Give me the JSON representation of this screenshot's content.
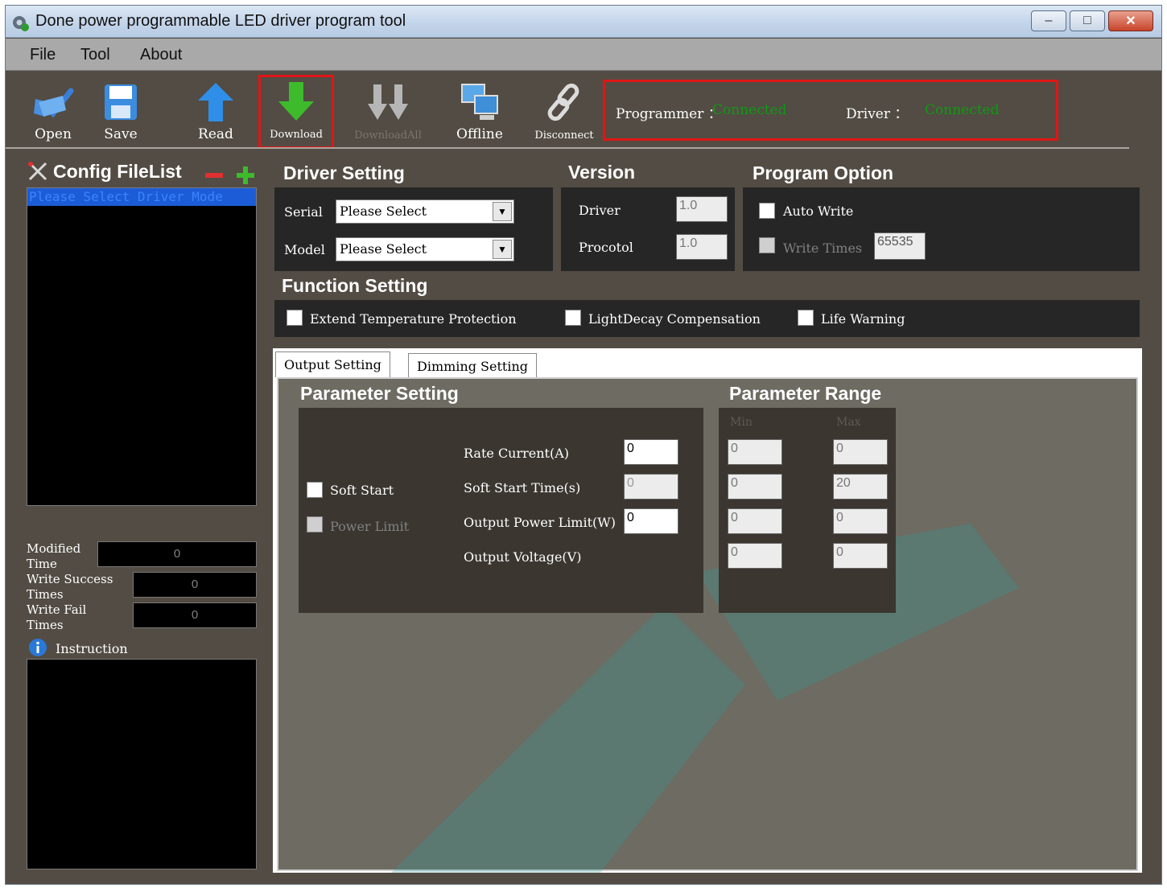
{
  "window": {
    "title": "Done power programmable LED driver program tool",
    "controls": {
      "minimize": "–",
      "maximize": "□",
      "close": "✕"
    }
  },
  "menu": [
    "File",
    "Tool",
    "About"
  ],
  "toolbar": {
    "buttons": [
      {
        "label": "Open",
        "icon": "folder-check-icon"
      },
      {
        "label": "Save",
        "icon": "floppy-disk-icon"
      },
      {
        "label": "Read",
        "icon": "arrow-up-icon"
      },
      {
        "label": "Download",
        "icon": "arrow-down-icon"
      },
      {
        "label": "DownloadAll",
        "icon": "double-arrow-down-icon"
      },
      {
        "label": "Offline",
        "icon": "computers-icon"
      },
      {
        "label": "Disconnect",
        "icon": "broken-link-icon"
      }
    ],
    "status": {
      "programmer_label": "Programmer ：",
      "programmer_value": "Connected",
      "driver_label": "Driver ：",
      "driver_value": "Connected"
    }
  },
  "sidebar": {
    "title": "Config FileList",
    "list_selected": "Please Select Driver Mode",
    "stats": [
      {
        "label": "Modified Time",
        "value": "0"
      },
      {
        "label": "Write Success Times",
        "value": "0"
      },
      {
        "label": "Write Fail Times",
        "value": "0"
      }
    ],
    "instruction_label": "Instruction"
  },
  "driver_setting": {
    "title": "Driver Setting",
    "serial_label": "Serial",
    "serial_value": "Please Select",
    "model_label": "Model",
    "model_value": "Please Select"
  },
  "version": {
    "title": "Version",
    "driver_label": "Driver",
    "driver_value": "1.0",
    "protocol_label": "Procotol",
    "protocol_value": "1.0"
  },
  "program_option": {
    "title": "Program Option",
    "auto_write": "Auto Write",
    "write_times_label": "Write Times",
    "write_times_value": "65535"
  },
  "function_setting": {
    "title": "Function Setting",
    "options": [
      "Extend Temperature Protection",
      "LightDecay Compensation",
      "Life Warning"
    ]
  },
  "tabs": [
    "Output Setting",
    "Dimming Setting"
  ],
  "parameter_setting": {
    "title": "Parameter Setting",
    "soft_start": "Soft Start",
    "power_limit": "Power Limit",
    "rows": [
      {
        "label": "Rate Current(A)",
        "value": "0"
      },
      {
        "label": "Soft Start Time(s)",
        "value": "0"
      },
      {
        "label": "Output Power Limit(W)",
        "value": "0"
      },
      {
        "label": "Output Voltage(V)",
        "value": ""
      }
    ]
  },
  "parameter_range": {
    "title": "Parameter Range",
    "min_label": "Min",
    "max_label": "Max",
    "rows": [
      {
        "min": "0",
        "max": "0"
      },
      {
        "min": "0",
        "max": "20"
      },
      {
        "min": "0",
        "max": "0"
      },
      {
        "min": "0",
        "max": "0"
      }
    ]
  },
  "colors": {
    "background": "#524c44",
    "panel": "#262626",
    "tab_content": "#6d6b62",
    "connected": "#0f9a12",
    "highlight": "#e01616",
    "selection": "#1c5cd6"
  }
}
